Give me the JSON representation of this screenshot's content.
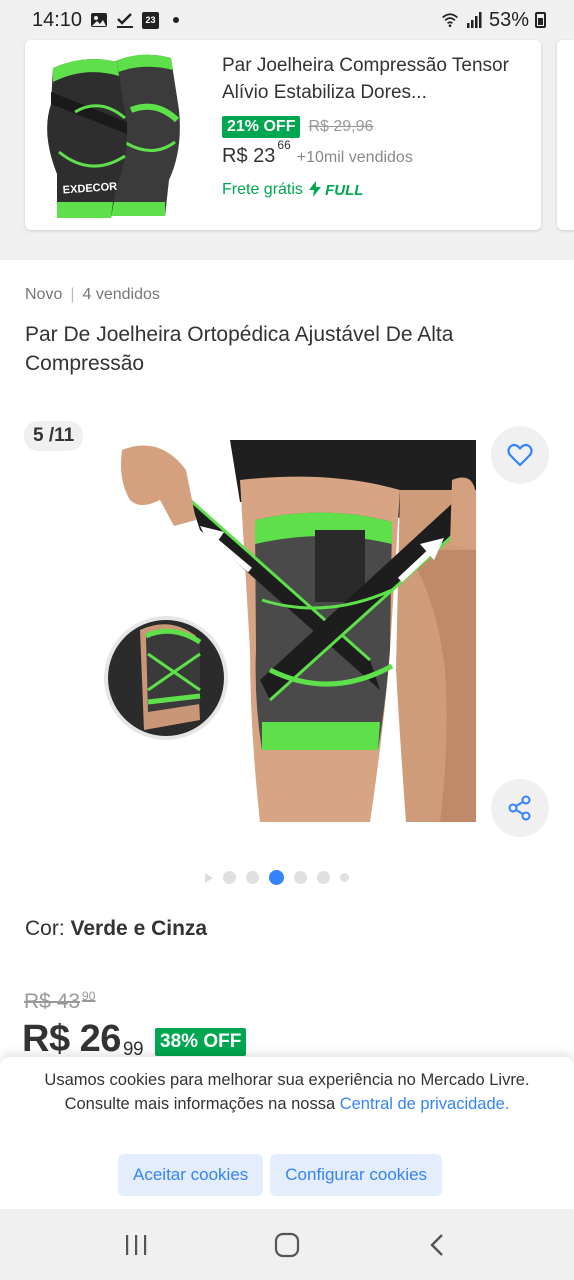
{
  "status_bar": {
    "time": "14:10",
    "calendar_day": "23",
    "battery": "53%",
    "icons": [
      "gallery-icon",
      "check-download-icon",
      "calendar-icon",
      "notification-dot-icon",
      "wifi-icon",
      "signal-icon",
      "battery-icon"
    ]
  },
  "recommendation": {
    "title": "Par Joelheira Compressão Tensor Alívio Estabiliza Dores...",
    "discount": "21% OFF",
    "old_price": "R$ 29,96",
    "price_currency": "R$",
    "price_int": "23",
    "price_cents": "66",
    "sold": "+10mil vendidos",
    "shipping": "Frete grátis",
    "full_label": "FULL",
    "brand_text": "EXDECOR"
  },
  "product": {
    "condition": "Novo",
    "sold": "4 vendidos",
    "title": "Par De Joelheira Ortopédica Ajustável De Alta Compressão",
    "image_counter": "5 /11",
    "color_label": "Cor:",
    "color_value": "Verde e Cinza",
    "old_price_int": "R$ 43",
    "old_price_cents": "90",
    "price_int": "R$ 26",
    "price_cents": "99",
    "discount": "38% OFF"
  },
  "gallery": {
    "dots_total": 6,
    "active_dot": 3
  },
  "cookie_banner": {
    "text": "Usamos cookies para melhorar sua experiência no Mercado Livre. Consulte mais informações na nossa ",
    "link": "Central de privacidade.",
    "accept": "Aceitar cookies",
    "configure": "Configurar cookies"
  },
  "nav_bar": {
    "icons": [
      "recent-apps-icon",
      "home-icon",
      "back-icon"
    ]
  },
  "colors": {
    "accent": "#3483fa",
    "discount_green": "#00a650",
    "sleeve_green": "#5ee04a",
    "background_gray": "#f0f0f0"
  }
}
